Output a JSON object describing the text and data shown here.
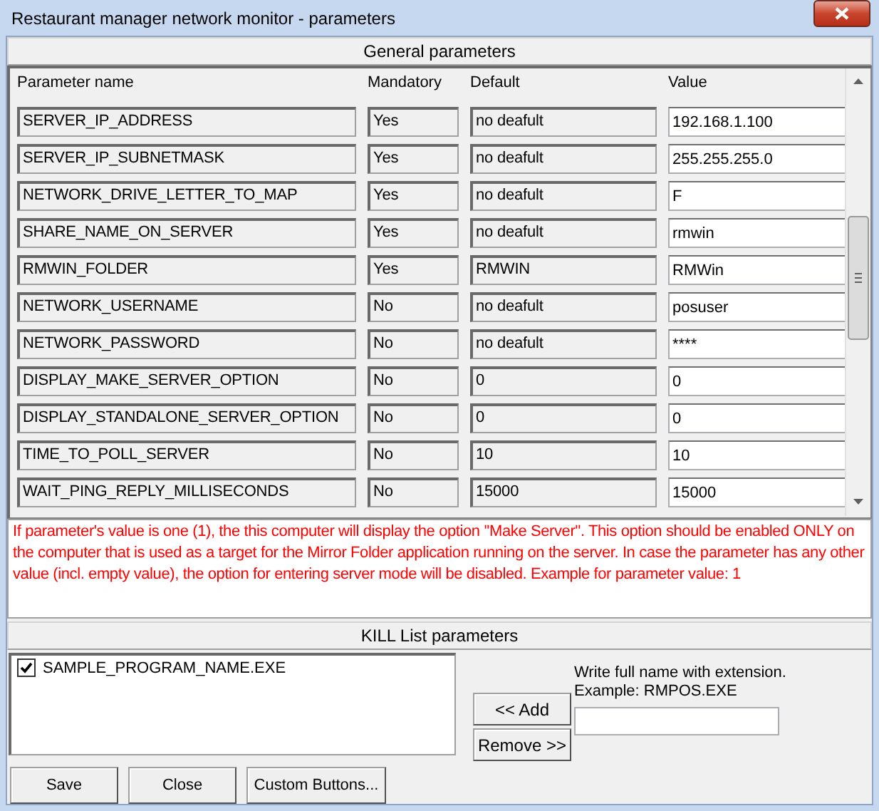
{
  "window": {
    "title": "Restaurant manager network monitor - parameters"
  },
  "general": {
    "heading": "General parameters",
    "columns": [
      "Parameter name",
      "Mandatory",
      "Default",
      "Value"
    ],
    "rows": [
      {
        "name": "SERVER_IP_ADDRESS",
        "mandatory": "Yes",
        "default": "no deafult",
        "value": "192.168.1.100"
      },
      {
        "name": "SERVER_IP_SUBNETMASK",
        "mandatory": "Yes",
        "default": "no deafult",
        "value": "255.255.255.0"
      },
      {
        "name": "NETWORK_DRIVE_LETTER_TO_MAP",
        "mandatory": "Yes",
        "default": "no deafult",
        "value": "F"
      },
      {
        "name": "SHARE_NAME_ON_SERVER",
        "mandatory": "Yes",
        "default": "no deafult",
        "value": "rmwin"
      },
      {
        "name": "RMWIN_FOLDER",
        "mandatory": "Yes",
        "default": "RMWIN",
        "value": "RMWin"
      },
      {
        "name": "NETWORK_USERNAME",
        "mandatory": "No",
        "default": "no deafult",
        "value": "posuser"
      },
      {
        "name": "NETWORK_PASSWORD",
        "mandatory": "No",
        "default": "no deafult",
        "value": "****"
      },
      {
        "name": "DISPLAY_MAKE_SERVER_OPTION",
        "mandatory": "No",
        "default": "0",
        "value": "0"
      },
      {
        "name": "DISPLAY_STANDALONE_SERVER_OPTION",
        "mandatory": "No",
        "default": "0",
        "value": "0"
      },
      {
        "name": "TIME_TO_POLL_SERVER",
        "mandatory": "No",
        "default": "10",
        "value": "10"
      },
      {
        "name": "WAIT_PING_REPLY_MILLISECONDS",
        "mandatory": "No",
        "default": "15000",
        "value": "15000"
      }
    ],
    "description": "If parameter's value is one (1), the this computer will display the option ''Make Server''.  This option should be enabled ONLY on the computer that is used as a target for the Mirror Folder application running on the server. In case the parameter has any other value (incl. empty value), the option for entering server mode will be disabled. Example for parameter value: 1"
  },
  "kill_list": {
    "heading": "KILL List parameters",
    "items": [
      {
        "label": "SAMPLE_PROGRAM_NAME.EXE",
        "checked": true
      }
    ],
    "add_button": "<< Add",
    "remove_button": "Remove >>",
    "hint": [
      "Write full name with extension.",
      "Example: RMPOS.EXE"
    ]
  },
  "buttons": [
    "Save",
    "Close",
    "Custom Buttons..."
  ]
}
